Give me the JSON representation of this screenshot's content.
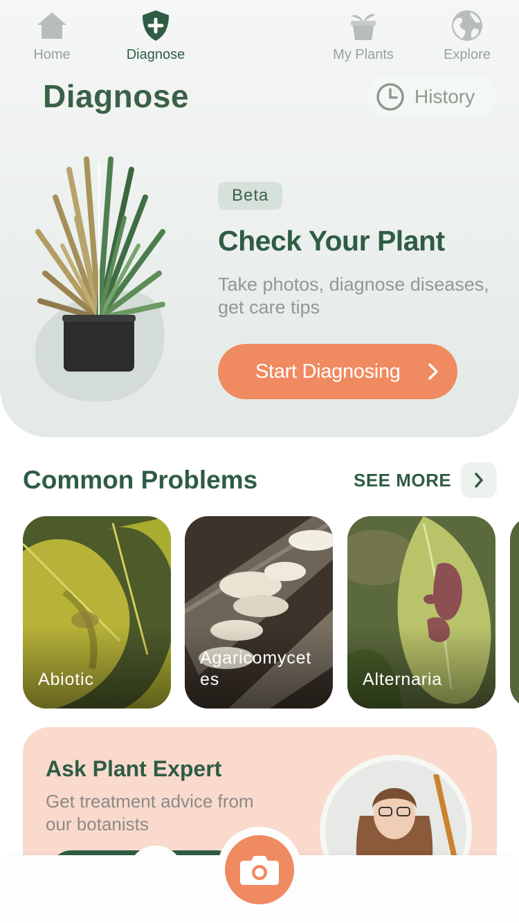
{
  "header": {
    "title": "Diagnose",
    "history_label": "History"
  },
  "hero": {
    "badge": "Beta",
    "headline": "Check Your Plant",
    "subtitle": "Take photos, diagnose diseases, get care tips",
    "cta_label": "Start Diagnosing"
  },
  "common_problems": {
    "title": "Common Problems",
    "see_more": "SEE MORE",
    "cards": [
      {
        "label": "Abiotic"
      },
      {
        "label": "Agaricomycetes"
      },
      {
        "label": "Alternaria"
      }
    ]
  },
  "expert": {
    "title": "Ask Plant Expert",
    "subtitle": "Get treatment advice from our botanists"
  },
  "nav": {
    "items": [
      {
        "label": "Home"
      },
      {
        "label": "Diagnose"
      },
      {
        "label": "My Plants"
      },
      {
        "label": "Explore"
      }
    ]
  },
  "colors": {
    "accent": "#f08a60",
    "brand_green": "#2f5c44",
    "hero_bg": "#e3e9e6",
    "expert_bg": "#f9dacd"
  }
}
